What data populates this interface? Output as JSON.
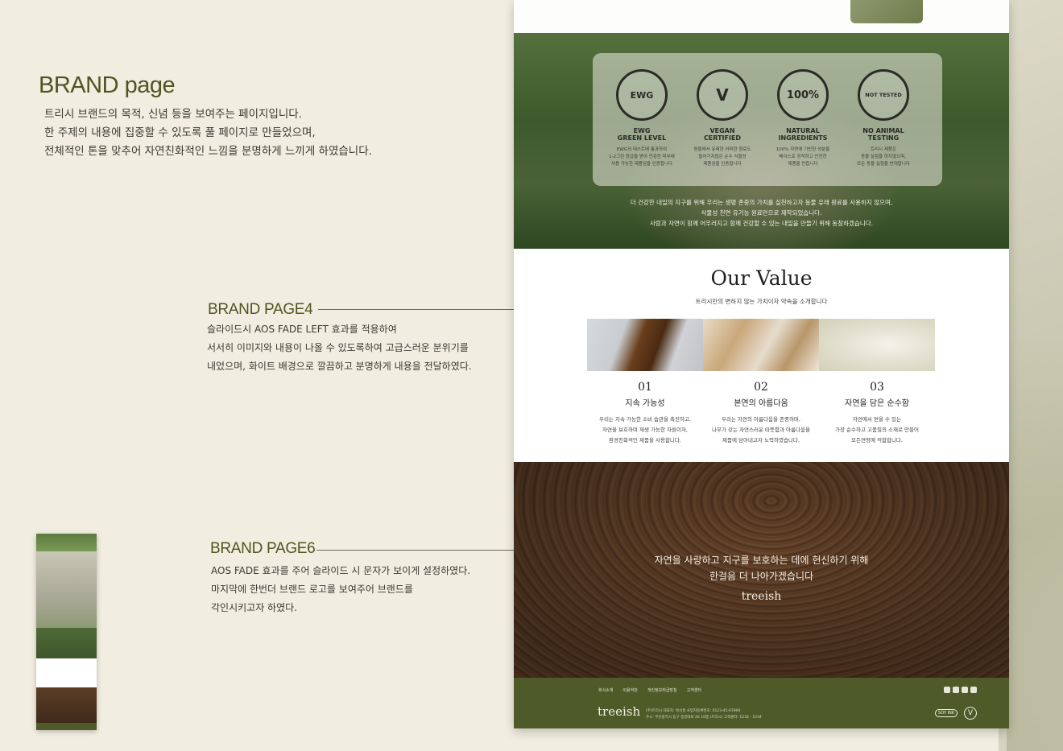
{
  "brand": {
    "title": "BRAND page",
    "description_lines": [
      "트리시 브랜드의 목적, 신념  등을 보여주는 페이지입니다.",
      "한 주제의 내용에 집중할 수 있도록 풀 페이지로 만들었으며,",
      "전체적인 톤을 맞추어 자연친화적인 느낌을 분명하게 느끼게 하였습니다."
    ]
  },
  "sections": [
    {
      "label": "BRAND PAGE4",
      "lines": [
        "슬라이드시 AOS FADE LEFT 효과를 적용하여",
        "서서히 이미지와 내용이 나올 수 있도록하여 고급스러운 분위기를",
        "내었으며, 화이트 배경으로 깔끔하고 분명하게 내용을 전달하였다."
      ]
    },
    {
      "label": "BRAND PAGE6",
      "lines": [
        "AOS FADE 효과를 주어 슬라이드 시 문자가 보이게 설정하였다.",
        "마지막에 한번더 브랜드 로고를 보여주어 브랜드를",
        "각인시키고자 하였다."
      ]
    }
  ],
  "certifications": [
    {
      "badge": "EWG",
      "name": "EWG\nGREEN LEVEL",
      "text": "EWG의 테스트에 통과하여\n1-2그린 등급을 받아 민감한 피부에\n사용 가능한 제품임을 인증합니다"
    },
    {
      "badge": "V",
      "name": "VEGAN\nCERTIFIED",
      "text": "동물에서 유래한 어떠한 원료도\n들어가지않은 순수 식물성\n제품임을 인증합니다"
    },
    {
      "badge": "100%",
      "name": "NATURAL\nINGREDIENTS",
      "text": "100% 자연에 기반한 성분을\n베이스로 정직하고 안전한\n제품을 만듭니다"
    },
    {
      "badge": "NOT TESTED",
      "name": "NO ANIMAL\nTESTING",
      "text": "트리시 제품은\n동물 실험을 하지않으며,\n모든 동물 실험을 반대합니다"
    }
  ],
  "forest_text": "더 건강한 내일의 지구를 위해 우리는 생명 존중의 가치를 실천하고자 동물 유래 원료를 사용하지 않으며,\n식물성 천연 유기농 원료만으로 제작되었습니다.\n사람과 자연이 함께 어우러지고 함께 건강할 수 있는 내일을 만들기 위해 동참하겠습니다.",
  "our_value": {
    "title": "Our Value",
    "subtitle": "트리시만의 변하지 않는 가치이자 약속을 소개합니다",
    "items": [
      {
        "num": "01",
        "name": "지속 가능성",
        "text": "우리는 지속 가능한 소비 습관을 촉진하고,\n자연을 보호하며 재생 가능한 자원이자,\n환경친화적인 제품을 사용합니다.",
        "color_a": "#cfd2d6",
        "color_b": "#6a3e1c"
      },
      {
        "num": "02",
        "name": "본연의 아름다움",
        "text": "우리는 자연의 아름다움을 존중하며,\n나무가 갖는 자연스러운 따뜻함과 아름다움을\n제품에 담아내고자 노력하였습니다.",
        "color_a": "#e5d9c6",
        "color_b": "#b8966a"
      },
      {
        "num": "03",
        "name": "자연을 담은 순수함",
        "text": "자연에서 얻을 수 있는\n가장 순수하고 고품질의 소재로 만들어\n모든연령에 적합합니다.",
        "color_a": "#efece3",
        "color_b": "#d8d4be"
      }
    ]
  },
  "wood": {
    "text": "자연을 사랑하고 지구를 보호하는 데에 헌신하기 위해\n한걸음 더 나아가겠습니다",
    "logo": "treeish"
  },
  "footer": {
    "links": [
      "회사소개",
      "이용약관",
      "개인정보취급방침",
      "고객센터"
    ],
    "logo": "treeish",
    "info": "(주)트리시   대표자: 박선생   사업자등록번호: 0123-45-67890\n주소: 부산광역시 동구 중앙대로 26 10층  (트리시)   고객센터: 1234 - 1234",
    "badge_soy": "SOY INK",
    "badge_v": "V"
  },
  "colors": {
    "accent": "#4d5620",
    "footer": "#4f5a29",
    "background": "#f1ede1"
  }
}
